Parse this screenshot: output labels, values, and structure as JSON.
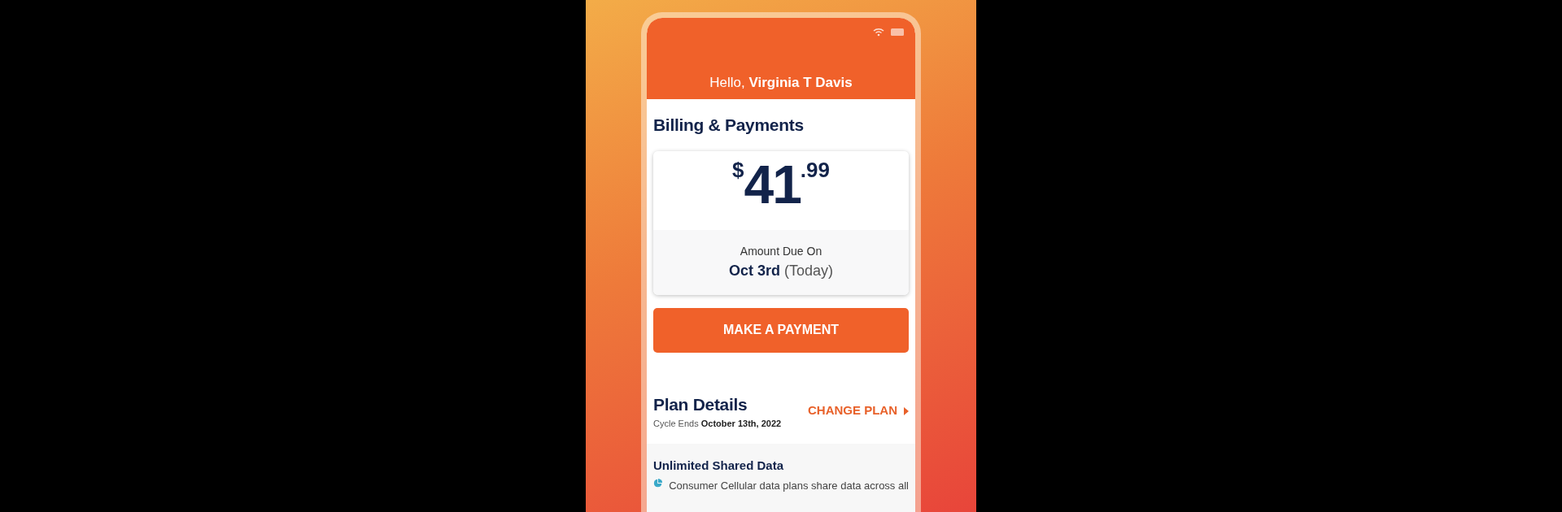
{
  "greeting": {
    "prefix": "Hello,",
    "name": "Virginia T Davis"
  },
  "billing": {
    "title": "Billing & Payments",
    "currency": "$",
    "dollars": "41",
    "cents": ".99",
    "due_label": "Amount Due On",
    "due_date": "Oct 3rd",
    "due_note": "(Today)",
    "button": "MAKE A PAYMENT"
  },
  "plan": {
    "title": "Plan Details",
    "cycle_label": "Cycle Ends",
    "cycle_date": "October 13th, 2022",
    "action": "CHANGE PLAN",
    "feature_title": "Unlimited Shared Data",
    "feature_text": "Consumer Cellular data plans share data across all"
  }
}
